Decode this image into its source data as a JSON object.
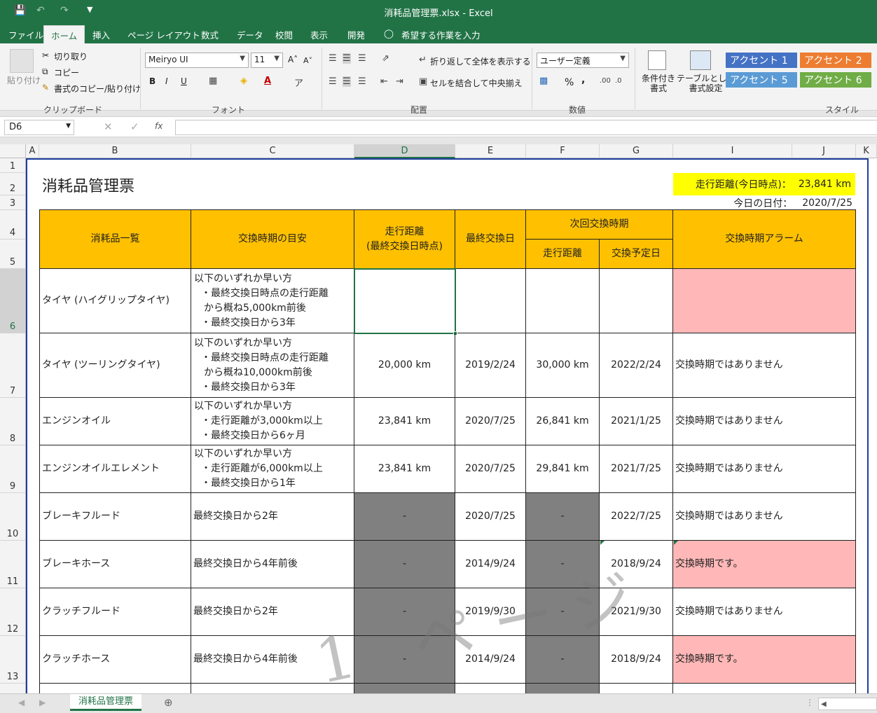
{
  "window": {
    "title": "消耗品管理票.xlsx  -  Excel"
  },
  "quick_access": {
    "save_icon": "save-icon",
    "undo_icon": "undo-icon",
    "redo_icon": "redo-icon",
    "customize_icon": "chevron-down-icon"
  },
  "menu": {
    "file": "ファイル",
    "home": "ホーム",
    "insert": "挿入",
    "page_layout": "ページ レイアウト",
    "formulas": "数式",
    "data": "データ",
    "review": "校閲",
    "view": "表示",
    "developer": "開発",
    "tellme": "希望する作業を入力"
  },
  "ribbon": {
    "clipboard": {
      "paste": "貼り付け",
      "cut": "切り取り",
      "copy": "コピー",
      "format_painter": "書式のコピー/貼り付け",
      "group": "クリップボード"
    },
    "font": {
      "name": "Meiryo UI",
      "size": "11",
      "bold": "B",
      "italic": "I",
      "underline": "U",
      "group": "フォント"
    },
    "alignment": {
      "wrap": "折り返して全体を表示する",
      "merge": "セルを結合して中央揃え",
      "group": "配置"
    },
    "number": {
      "format": "ユーザー定義",
      "percent": "%",
      "comma": ",",
      "group": "数値"
    },
    "styles": {
      "conditional": "条件付き\n書式",
      "table": "テーブルとして\n書式設定",
      "accent1": "アクセント 1",
      "accent2": "アクセント 2",
      "accent5": "アクセント 5",
      "accent6": "アクセント 6",
      "group": "スタイル"
    }
  },
  "formula_bar": {
    "name_box": "D6",
    "fx": "fx",
    "value": ""
  },
  "columns": [
    "A",
    "B",
    "C",
    "D",
    "E",
    "F",
    "G",
    "I",
    "J",
    "K"
  ],
  "rows": [
    "1",
    "2",
    "3",
    "4",
    "5",
    "6",
    "7",
    "8",
    "9",
    "10",
    "11",
    "12",
    "13"
  ],
  "sheet": {
    "title": "消耗品管理票",
    "mileage_label": "走行距離(今日時点)：",
    "mileage_value": "23,841 km",
    "today_label": "今日の日付：",
    "today_value": "2020/7/25",
    "headers": {
      "item": "消耗品一覧",
      "guide": "交換時期の目安",
      "mileage_last_1": "走行距離",
      "mileage_last_2": "(最終交換日時点)",
      "last_date": "最終交換日",
      "next": "次回交換時期",
      "next_mileage": "走行距離",
      "next_date": "交換予定日",
      "alarm": "交換時期アラーム"
    },
    "rows": [
      {
        "item": "タイヤ (ハイグリップタイヤ)",
        "guide": [
          "以下のいずれか早い方",
          "・最終交換日時点の走行距離",
          "から概ね5,000km前後",
          "・最終交換日から3年"
        ],
        "mileage": "",
        "last": "",
        "next_mileage": "",
        "next_date": "",
        "alarm": ""
      },
      {
        "item": "タイヤ (ツーリングタイヤ)",
        "guide": [
          "以下のいずれか早い方",
          "・最終交換日時点の走行距離",
          "から概ね10,000km前後",
          "・最終交換日から3年"
        ],
        "mileage": "20,000 km",
        "last": "2019/2/24",
        "next_mileage": "30,000 km",
        "next_date": "2022/2/24",
        "alarm": "交換時期ではありません"
      },
      {
        "item": "エンジンオイル",
        "guide": [
          "以下のいずれか早い方",
          "・走行距離が3,000km以上",
          "・最終交換日から6ヶ月"
        ],
        "mileage": "23,841 km",
        "last": "2020/7/25",
        "next_mileage": "26,841 km",
        "next_date": "2021/1/25",
        "alarm": "交換時期ではありません"
      },
      {
        "item": "エンジンオイルエレメント",
        "guide": [
          "以下のいずれか早い方",
          "・走行距離が6,000km以上",
          "・最終交換日から1年"
        ],
        "mileage": "23,841 km",
        "last": "2020/7/25",
        "next_mileage": "29,841 km",
        "next_date": "2021/7/25",
        "alarm": "交換時期ではありません"
      },
      {
        "item": "ブレーキフルード",
        "guide": [
          "最終交換日から2年"
        ],
        "mileage": "-",
        "last": "2020/7/25",
        "next_mileage": "-",
        "next_date": "2022/7/25",
        "alarm": "交換時期ではありません"
      },
      {
        "item": "ブレーキホース",
        "guide": [
          "最終交換日から4年前後"
        ],
        "mileage": "-",
        "last": "2014/9/24",
        "next_mileage": "-",
        "next_date": "2018/9/24",
        "alarm": "交換時期です。"
      },
      {
        "item": "クラッチフルード",
        "guide": [
          "最終交換日から2年"
        ],
        "mileage": "-",
        "last": "2019/9/30",
        "next_mileage": "-",
        "next_date": "2021/9/30",
        "alarm": "交換時期ではありません"
      },
      {
        "item": "クラッチホース",
        "guide": [
          "最終交換日から4年前後"
        ],
        "mileage": "-",
        "last": "2014/9/24",
        "next_mileage": "-",
        "next_date": "2018/9/24",
        "alarm": "交換時期です。"
      }
    ],
    "watermark": "1 ページ"
  },
  "tabs": {
    "sheet1": "消耗品管理票"
  }
}
